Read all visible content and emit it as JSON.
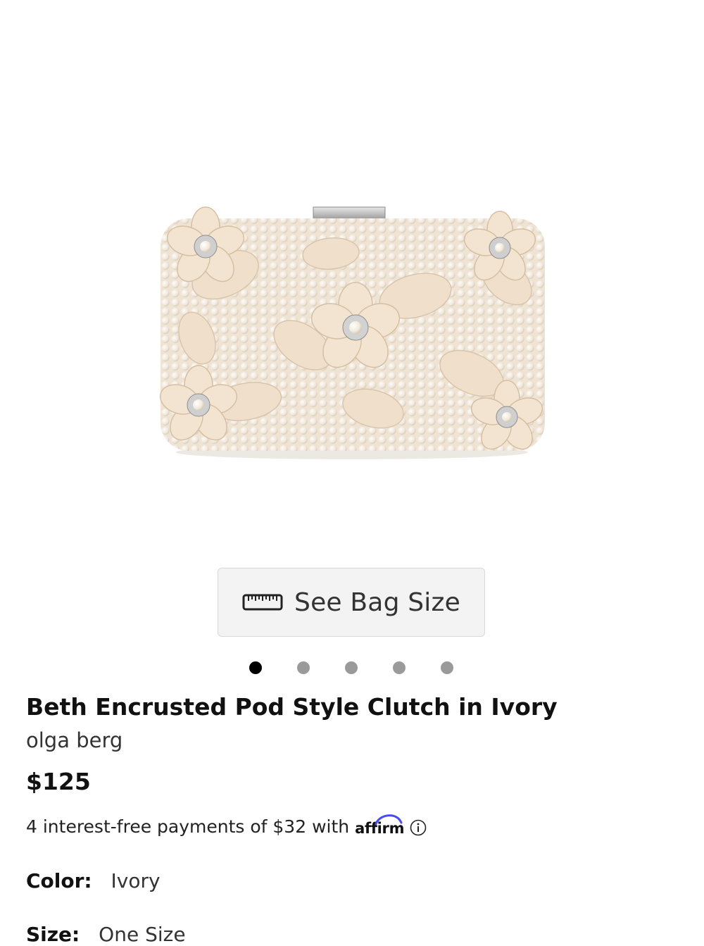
{
  "gallery": {
    "image_alt": "Beth Encrusted Pod Style Clutch in Ivory",
    "slide_count": 5,
    "active_slide": 1
  },
  "size_button": {
    "label": "See Bag Size",
    "icon": "ruler-icon"
  },
  "product": {
    "title": "Beth Encrusted Pod Style Clutch in Ivory",
    "brand": "olga berg",
    "price": "$125"
  },
  "financing": {
    "text": "4 interest-free payments of $32 with",
    "provider_logo": "affirm",
    "info_icon": "info-icon",
    "accent_color": "#4a4af4"
  },
  "attributes": {
    "color_label": "Color:",
    "color_value": "Ivory",
    "size_label": "Size:",
    "size_value": "One Size"
  }
}
